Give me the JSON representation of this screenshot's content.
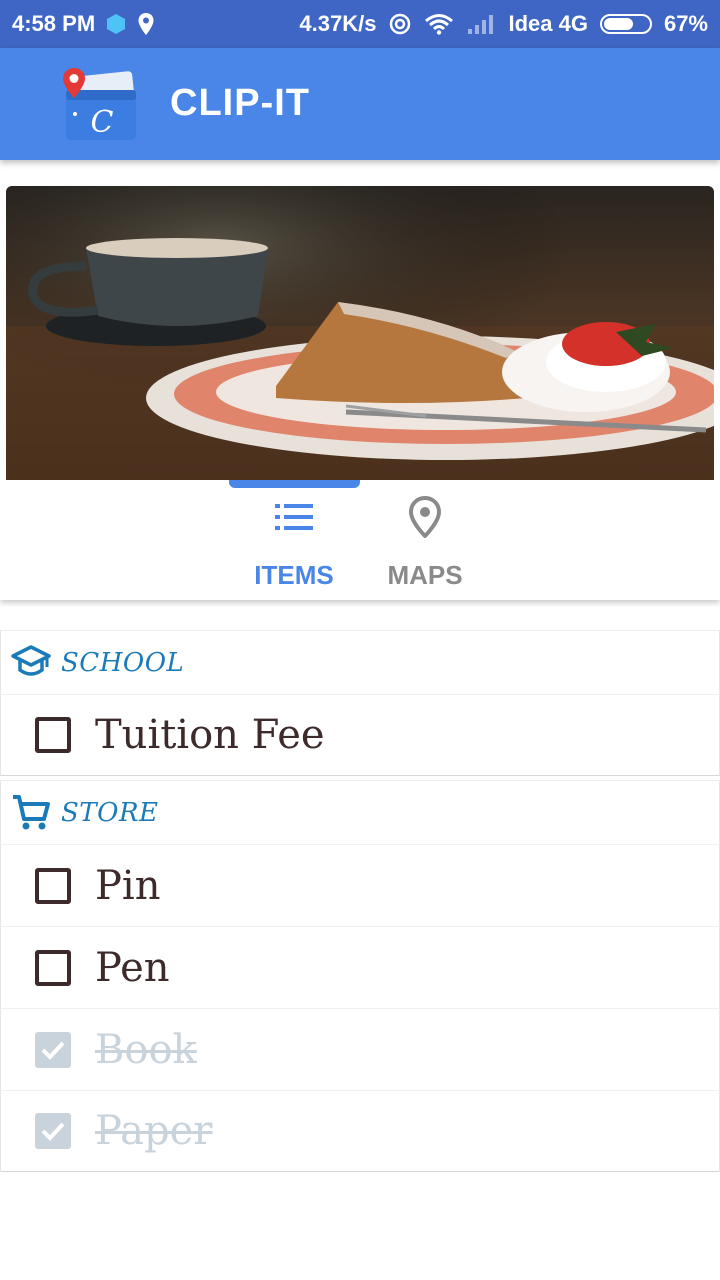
{
  "status_bar": {
    "time": "4:58 PM",
    "speed": "4.37K/s",
    "carrier": "Idea 4G",
    "battery": "67%",
    "battery_level": 0.67
  },
  "app_bar": {
    "title": "CLIP-IT",
    "logo_icon": "clip-it-wallet-logo"
  },
  "tabs": [
    {
      "label": "ITEMS",
      "icon": "list-icon",
      "active": true,
      "color": "#4a86e8"
    },
    {
      "label": "MAPS",
      "icon": "map-pin-icon",
      "active": false,
      "color": "#8a8a8a"
    }
  ],
  "sections": [
    {
      "label": "SCHOOL",
      "icon": "graduation-cap-icon",
      "items": [
        {
          "label": "Tuition Fee",
          "checked": false
        }
      ]
    },
    {
      "label": "STORE",
      "icon": "shopping-cart-icon",
      "items": [
        {
          "label": "Pin",
          "checked": false
        },
        {
          "label": "Pen",
          "checked": false
        },
        {
          "label": "Book",
          "checked": true
        },
        {
          "label": "Paper",
          "checked": true
        }
      ]
    }
  ],
  "colors": {
    "status_bar": "#3f66c4",
    "app_bar": "#4a86e8",
    "section_label": "#1b7bb8",
    "item_text": "#3d2a2a",
    "checked_item": "#c9d3dc"
  }
}
